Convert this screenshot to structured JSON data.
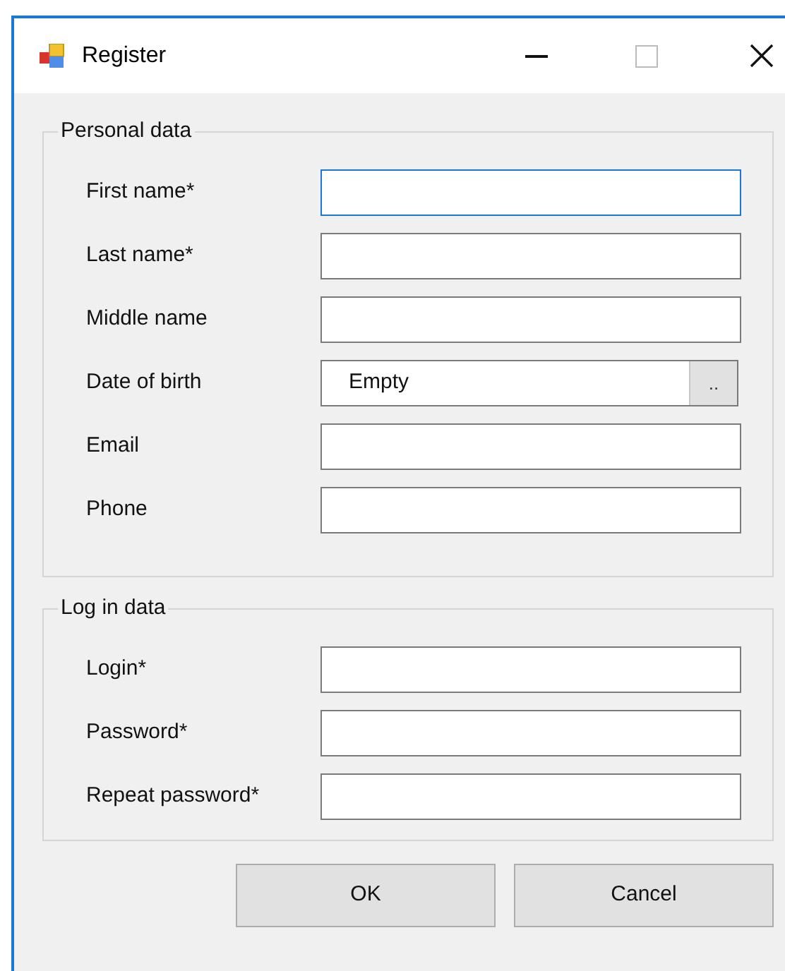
{
  "window": {
    "title": "Register"
  },
  "groups": [
    {
      "title": "Personal data",
      "fields": [
        {
          "label": "First name*",
          "kind": "text",
          "focused": true
        },
        {
          "label": "Last name*",
          "kind": "text",
          "focused": false
        },
        {
          "label": "Middle name",
          "kind": "text",
          "focused": false
        },
        {
          "label": "Date of birth",
          "kind": "date",
          "value": "Empty",
          "button": "..",
          "focused": false
        },
        {
          "label": "Email",
          "kind": "text",
          "focused": false
        },
        {
          "label": "Phone",
          "kind": "text",
          "focused": false
        }
      ]
    },
    {
      "title": "Log in data",
      "fields": [
        {
          "label": "Login*",
          "kind": "text",
          "focused": false
        },
        {
          "label": "Password*",
          "kind": "text",
          "focused": false
        },
        {
          "label": "Repeat password*",
          "kind": "text",
          "focused": false
        }
      ]
    }
  ],
  "buttons": [
    "OK",
    "Cancel"
  ]
}
